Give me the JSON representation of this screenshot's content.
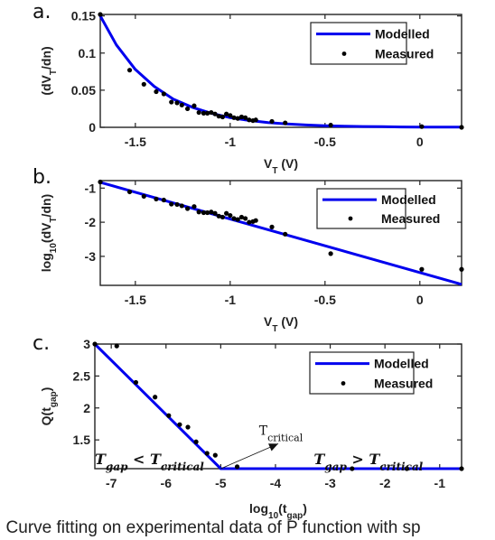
{
  "caption": ". Curve fitting on experimental data of P function with sp",
  "colors": {
    "model": "#0000ee",
    "measured": "#000000",
    "axis": "#222222"
  },
  "chart_data": [
    {
      "panel": "a.",
      "type": "line",
      "xlabel": "V_T (V)",
      "ylabel": "(dV_T/dn)",
      "xlim": [
        -1.685,
        0.22
      ],
      "ylim": [
        0,
        0.152
      ],
      "xticks": [
        -1.5,
        -1,
        -0.5,
        0
      ],
      "xtick_labels": [
        "-1.5",
        "-1",
        "-0.5",
        "0"
      ],
      "yticks": [
        0,
        0.05,
        0.1,
        0.15
      ],
      "ytick_labels": [
        "0",
        "0.05",
        "0.1",
        "0.15"
      ],
      "grid": false,
      "legend": {
        "position": "top-right",
        "entries": [
          "Modelled",
          "Measured"
        ]
      },
      "series": [
        {
          "name": "Modelled",
          "style": "line",
          "x": [
            -1.685,
            -1.6,
            -1.5,
            -1.4,
            -1.3,
            -1.2,
            -1.1,
            -1.0,
            -0.9,
            -0.8,
            -0.7,
            -0.6,
            -0.5,
            -0.4,
            -0.3,
            -0.2,
            -0.1,
            0.0,
            0.1,
            0.22
          ],
          "y": [
            0.15,
            0.111,
            0.078,
            0.055,
            0.038,
            0.027,
            0.019,
            0.013,
            0.0092,
            0.0064,
            0.0045,
            0.0032,
            0.0022,
            0.0015,
            0.0011,
            0.0008,
            0.0005,
            0.0004,
            0.0003,
            0.0002
          ]
        },
        {
          "name": "Measured",
          "style": "points",
          "x": [
            -1.685,
            -1.53,
            -1.455,
            -1.39,
            -1.35,
            -1.31,
            -1.28,
            -1.255,
            -1.225,
            -1.19,
            -1.165,
            -1.14,
            -1.12,
            -1.1,
            -1.08,
            -1.06,
            -1.04,
            -1.02,
            -1.0,
            -0.98,
            -0.96,
            -0.94,
            -0.92,
            -0.9,
            -0.88,
            -0.865,
            -0.78,
            -0.71,
            -0.47,
            0.01,
            0.22
          ],
          "y": [
            0.152,
            0.077,
            0.058,
            0.048,
            0.045,
            0.034,
            0.033,
            0.03,
            0.025,
            0.029,
            0.02,
            0.019,
            0.019,
            0.02,
            0.018,
            0.015,
            0.014,
            0.018,
            0.016,
            0.013,
            0.012,
            0.014,
            0.013,
            0.01,
            0.009,
            0.01,
            0.008,
            0.006,
            0.003,
            0.001,
            0.0
          ]
        }
      ]
    },
    {
      "panel": "b.",
      "type": "line",
      "xlabel": "V_T (V)",
      "ylabel": "log10(dV_T/dn)",
      "xlim": [
        -1.685,
        0.22
      ],
      "ylim": [
        -3.85,
        -0.78
      ],
      "xticks": [
        -1.5,
        -1,
        -0.5,
        0
      ],
      "xtick_labels": [
        "-1.5",
        "-1",
        "-0.5",
        "0"
      ],
      "yticks": [
        -1,
        -2,
        -3
      ],
      "ytick_labels": [
        "-1",
        "-2",
        "-3"
      ],
      "grid": false,
      "legend": {
        "position": "top-right",
        "entries": [
          "Modelled",
          "Measured"
        ]
      },
      "series": [
        {
          "name": "Modelled",
          "style": "line",
          "x": [
            -1.685,
            0.22
          ],
          "y": [
            -0.83,
            -3.82
          ]
        },
        {
          "name": "Measured",
          "style": "points",
          "x": [
            -1.685,
            -1.53,
            -1.455,
            -1.39,
            -1.35,
            -1.31,
            -1.28,
            -1.255,
            -1.225,
            -1.19,
            -1.165,
            -1.14,
            -1.12,
            -1.1,
            -1.08,
            -1.06,
            -1.04,
            -1.02,
            -1.0,
            -0.98,
            -0.96,
            -0.94,
            -0.92,
            -0.9,
            -0.88,
            -0.865,
            -0.78,
            -0.71,
            -0.47,
            0.01,
            0.22
          ],
          "y": [
            -0.82,
            -1.11,
            -1.24,
            -1.32,
            -1.35,
            -1.47,
            -1.48,
            -1.52,
            -1.6,
            -1.54,
            -1.7,
            -1.72,
            -1.72,
            -1.7,
            -1.74,
            -1.82,
            -1.85,
            -1.74,
            -1.8,
            -1.89,
            -1.92,
            -1.85,
            -1.89,
            -2.0,
            -1.98,
            -1.95,
            -2.14,
            -2.35,
            -2.92,
            -3.38,
            -3.38
          ]
        }
      ]
    },
    {
      "panel": "c.",
      "type": "line",
      "xlabel": "log10(t_gap)",
      "ylabel": "Q(t_gap)",
      "xlim": [
        -7.3,
        -0.6
      ],
      "ylim": [
        1.05,
        3.0
      ],
      "xticks": [
        -7,
        -6,
        -5,
        -4,
        -3,
        -2,
        -1
      ],
      "xtick_labels": [
        "-7",
        "-6",
        "-5",
        "-4",
        "-3",
        "-2",
        "-1"
      ],
      "yticks": [
        1.5,
        2,
        2.5,
        3
      ],
      "ytick_labels": [
        "1.5",
        "2",
        "2.5",
        "3"
      ],
      "grid": false,
      "legend": {
        "position": "top-right",
        "entries": [
          "Modelled",
          "Measured"
        ]
      },
      "annotations": [
        {
          "text_main": "T",
          "text_sub": "gap",
          "op": " < ",
          "text_main2": "T",
          "text_sub2": "critical",
          "x": -7.3,
          "y": 1.12
        },
        {
          "text_main": "T",
          "text_sub": "gap",
          "op": " > ",
          "text_main2": "T",
          "text_sub2": "critical",
          "x": -3.3,
          "y": 1.12
        },
        {
          "text_main": "T",
          "text_sub": "critical",
          "x": -4.3,
          "y": 1.58,
          "arrow_from": [
            -5.0,
            1.05
          ],
          "arrow_to": [
            -3.95,
            1.44
          ]
        }
      ],
      "series": [
        {
          "name": "Modelled",
          "style": "line",
          "x": [
            -7.3,
            -5.0,
            -0.6
          ],
          "y": [
            3.0,
            1.05,
            1.05
          ]
        },
        {
          "name": "Measured",
          "style": "points",
          "x": [
            -7.3,
            -6.9,
            -6.55,
            -6.2,
            -5.95,
            -5.75,
            -5.6,
            -5.45,
            -5.25,
            -5.1,
            -4.7,
            -2.6,
            -1.6,
            -0.6
          ],
          "y": [
            3.0,
            2.97,
            2.4,
            2.17,
            1.88,
            1.74,
            1.7,
            1.47,
            1.29,
            1.26,
            1.08,
            1.05,
            1.05,
            1.05
          ]
        }
      ]
    }
  ]
}
